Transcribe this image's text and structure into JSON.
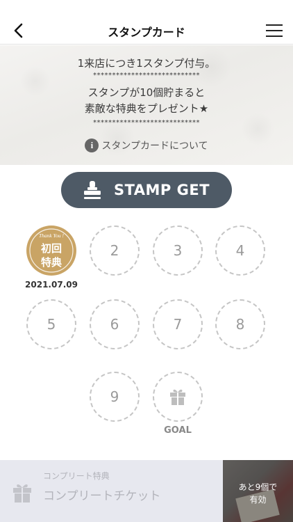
{
  "nav": {
    "title": "スタンプカード"
  },
  "info": {
    "line1": "1来店につき1スタンプ付与。",
    "separator": "****************************",
    "line2": "スタンプが10個貯まると",
    "line3": "素敵な特典をプレゼント★",
    "about_icon_glyph": "i",
    "about_label": "スタンプカードについて"
  },
  "stamp_button": {
    "label": "STAMP GET"
  },
  "stamps": {
    "first": {
      "badge_top": "Thank You !",
      "badge_line1": "初回",
      "badge_line2": "特典",
      "date": "2021.07.09",
      "color": "#c9a465"
    },
    "slots": [
      "2",
      "3",
      "4",
      "5",
      "6",
      "7",
      "8",
      "9"
    ],
    "goal_label": "GOAL"
  },
  "complete": {
    "caption": "コンプリート特典",
    "ticket": "コンプリートチケット",
    "remaining_line1": "あと9個で",
    "remaining_line2": "有効"
  }
}
